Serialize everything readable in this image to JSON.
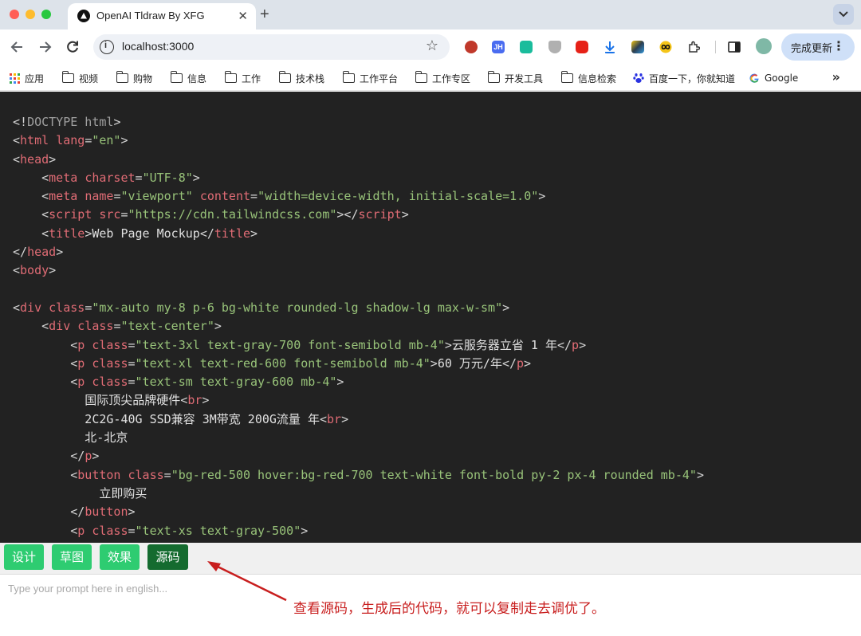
{
  "tab": {
    "title": "OpenAI Tldraw By XFG",
    "close": "✕",
    "new_tab": "+"
  },
  "toolbar": {
    "url": "localhost:3000",
    "info": "i",
    "update_label": "完成更新",
    "update_menu": "⋮",
    "extensions": [
      "santa-icon",
      "jh-icon",
      "refresh-ext-icon",
      "shield-icon",
      "youtube-icon",
      "download-icon",
      "puzzle-color-icon",
      "infinity-icon",
      "extensions-icon",
      "sidepanel-icon"
    ],
    "ext_jh": "JH"
  },
  "bookmarks": {
    "items": [
      "应用",
      "视频",
      "购物",
      "信息",
      "工作",
      "技术栈",
      "工作平台",
      "工作专区",
      "开发工具",
      "信息检索",
      "百度一下，你就知道",
      "Google"
    ],
    "more": "»"
  },
  "code": {
    "lines": [
      [
        [
          "pu",
          "<!"
        ],
        [
          "dt",
          "DOCTYPE html"
        ],
        [
          "pu",
          ">"
        ]
      ],
      [
        [
          "pu",
          "<"
        ],
        [
          "tg",
          "html"
        ],
        [
          "pu",
          " "
        ],
        [
          "at",
          "lang"
        ],
        [
          "pu",
          "="
        ],
        [
          "st",
          "\"en\""
        ],
        [
          "pu",
          ">"
        ]
      ],
      [
        [
          "pu",
          "<"
        ],
        [
          "tg",
          "head"
        ],
        [
          "pu",
          ">"
        ]
      ],
      [
        [
          "pu",
          "    <"
        ],
        [
          "tg",
          "meta"
        ],
        [
          "pu",
          " "
        ],
        [
          "at",
          "charset"
        ],
        [
          "pu",
          "="
        ],
        [
          "st",
          "\"UTF-8\""
        ],
        [
          "pu",
          ">"
        ]
      ],
      [
        [
          "pu",
          "    <"
        ],
        [
          "tg",
          "meta"
        ],
        [
          "pu",
          " "
        ],
        [
          "at",
          "name"
        ],
        [
          "pu",
          "="
        ],
        [
          "st",
          "\"viewport\""
        ],
        [
          "pu",
          " "
        ],
        [
          "at",
          "content"
        ],
        [
          "pu",
          "="
        ],
        [
          "st",
          "\"width=device-width, initial-scale=1.0\""
        ],
        [
          "pu",
          ">"
        ]
      ],
      [
        [
          "pu",
          "    <"
        ],
        [
          "tg",
          "script"
        ],
        [
          "pu",
          " "
        ],
        [
          "at",
          "src"
        ],
        [
          "pu",
          "="
        ],
        [
          "st",
          "\"https://cdn.tailwindcss.com\""
        ],
        [
          "pu",
          "></"
        ],
        [
          "tg",
          "script"
        ],
        [
          "pu",
          ">"
        ]
      ],
      [
        [
          "pu",
          "    <"
        ],
        [
          "tg",
          "title"
        ],
        [
          "pu",
          ">"
        ],
        [
          "tx",
          "Web Page Mockup"
        ],
        [
          "pu",
          "</"
        ],
        [
          "tg",
          "title"
        ],
        [
          "pu",
          ">"
        ]
      ],
      [
        [
          "pu",
          "</"
        ],
        [
          "tg",
          "head"
        ],
        [
          "pu",
          ">"
        ]
      ],
      [
        [
          "pu",
          "<"
        ],
        [
          "tg",
          "body"
        ],
        [
          "pu",
          ">"
        ]
      ],
      [],
      [
        [
          "pu",
          "<"
        ],
        [
          "tg",
          "div"
        ],
        [
          "pu",
          " "
        ],
        [
          "at",
          "class"
        ],
        [
          "pu",
          "="
        ],
        [
          "st",
          "\"mx-auto my-8 p-6 bg-white rounded-lg shadow-lg max-w-sm\""
        ],
        [
          "pu",
          ">"
        ]
      ],
      [
        [
          "pu",
          "    <"
        ],
        [
          "tg",
          "div"
        ],
        [
          "pu",
          " "
        ],
        [
          "at",
          "class"
        ],
        [
          "pu",
          "="
        ],
        [
          "st",
          "\"text-center\""
        ],
        [
          "pu",
          ">"
        ]
      ],
      [
        [
          "pu",
          "        <"
        ],
        [
          "tg",
          "p"
        ],
        [
          "pu",
          " "
        ],
        [
          "at",
          "class"
        ],
        [
          "pu",
          "="
        ],
        [
          "st",
          "\"text-3xl text-gray-700 font-semibold mb-4\""
        ],
        [
          "pu",
          ">"
        ],
        [
          "tx",
          "云服务器立省 1 年"
        ],
        [
          "pu",
          "</"
        ],
        [
          "tg",
          "p"
        ],
        [
          "pu",
          ">"
        ]
      ],
      [
        [
          "pu",
          "        <"
        ],
        [
          "tg",
          "p"
        ],
        [
          "pu",
          " "
        ],
        [
          "at",
          "class"
        ],
        [
          "pu",
          "="
        ],
        [
          "st",
          "\"text-xl text-red-600 font-semibold mb-4\""
        ],
        [
          "pu",
          ">"
        ],
        [
          "tx",
          "60 万元/年"
        ],
        [
          "pu",
          "</"
        ],
        [
          "tg",
          "p"
        ],
        [
          "pu",
          ">"
        ]
      ],
      [
        [
          "pu",
          "        <"
        ],
        [
          "tg",
          "p"
        ],
        [
          "pu",
          " "
        ],
        [
          "at",
          "class"
        ],
        [
          "pu",
          "="
        ],
        [
          "st",
          "\"text-sm text-gray-600 mb-4\""
        ],
        [
          "pu",
          ">"
        ]
      ],
      [
        [
          "tx",
          "          国际顶尖品牌硬件"
        ],
        [
          "pu",
          "<"
        ],
        [
          "tg",
          "br"
        ],
        [
          "pu",
          ">"
        ]
      ],
      [
        [
          "tx",
          "          2C2G-40G SSD兼容 3M带宽 200G流量 年"
        ],
        [
          "pu",
          "<"
        ],
        [
          "tg",
          "br"
        ],
        [
          "pu",
          ">"
        ]
      ],
      [
        [
          "tx",
          "          北-北京"
        ]
      ],
      [
        [
          "pu",
          "        </"
        ],
        [
          "tg",
          "p"
        ],
        [
          "pu",
          ">"
        ]
      ],
      [
        [
          "pu",
          "        <"
        ],
        [
          "tg",
          "button"
        ],
        [
          "pu",
          " "
        ],
        [
          "at",
          "class"
        ],
        [
          "pu",
          "="
        ],
        [
          "st",
          "\"bg-red-500 hover:bg-red-700 text-white font-bold py-2 px-4 rounded mb-4\""
        ],
        [
          "pu",
          ">"
        ]
      ],
      [
        [
          "tx",
          "            立即购买"
        ]
      ],
      [
        [
          "pu",
          "        </"
        ],
        [
          "tg",
          "button"
        ],
        [
          "pu",
          ">"
        ]
      ],
      [
        [
          "pu",
          "        <"
        ],
        [
          "tg",
          "p"
        ],
        [
          "pu",
          " "
        ],
        [
          "at",
          "class"
        ],
        [
          "pu",
          "="
        ],
        [
          "st",
          "\"text-xs text-gray-500\""
        ],
        [
          "pu",
          ">"
        ]
      ]
    ]
  },
  "modes": {
    "design": "设计",
    "sketch": "草图",
    "preview": "效果",
    "source": "源码"
  },
  "prompt": {
    "placeholder": "Type your prompt here in english..."
  },
  "annotation": {
    "text": "查看源码，生成后的代码，就可以复制走去调优了。"
  },
  "colors": {
    "mode_green": "#2ecc71",
    "mode_active": "#146b2f",
    "code_bg": "#222222",
    "annotation_red": "#c81e1e"
  }
}
